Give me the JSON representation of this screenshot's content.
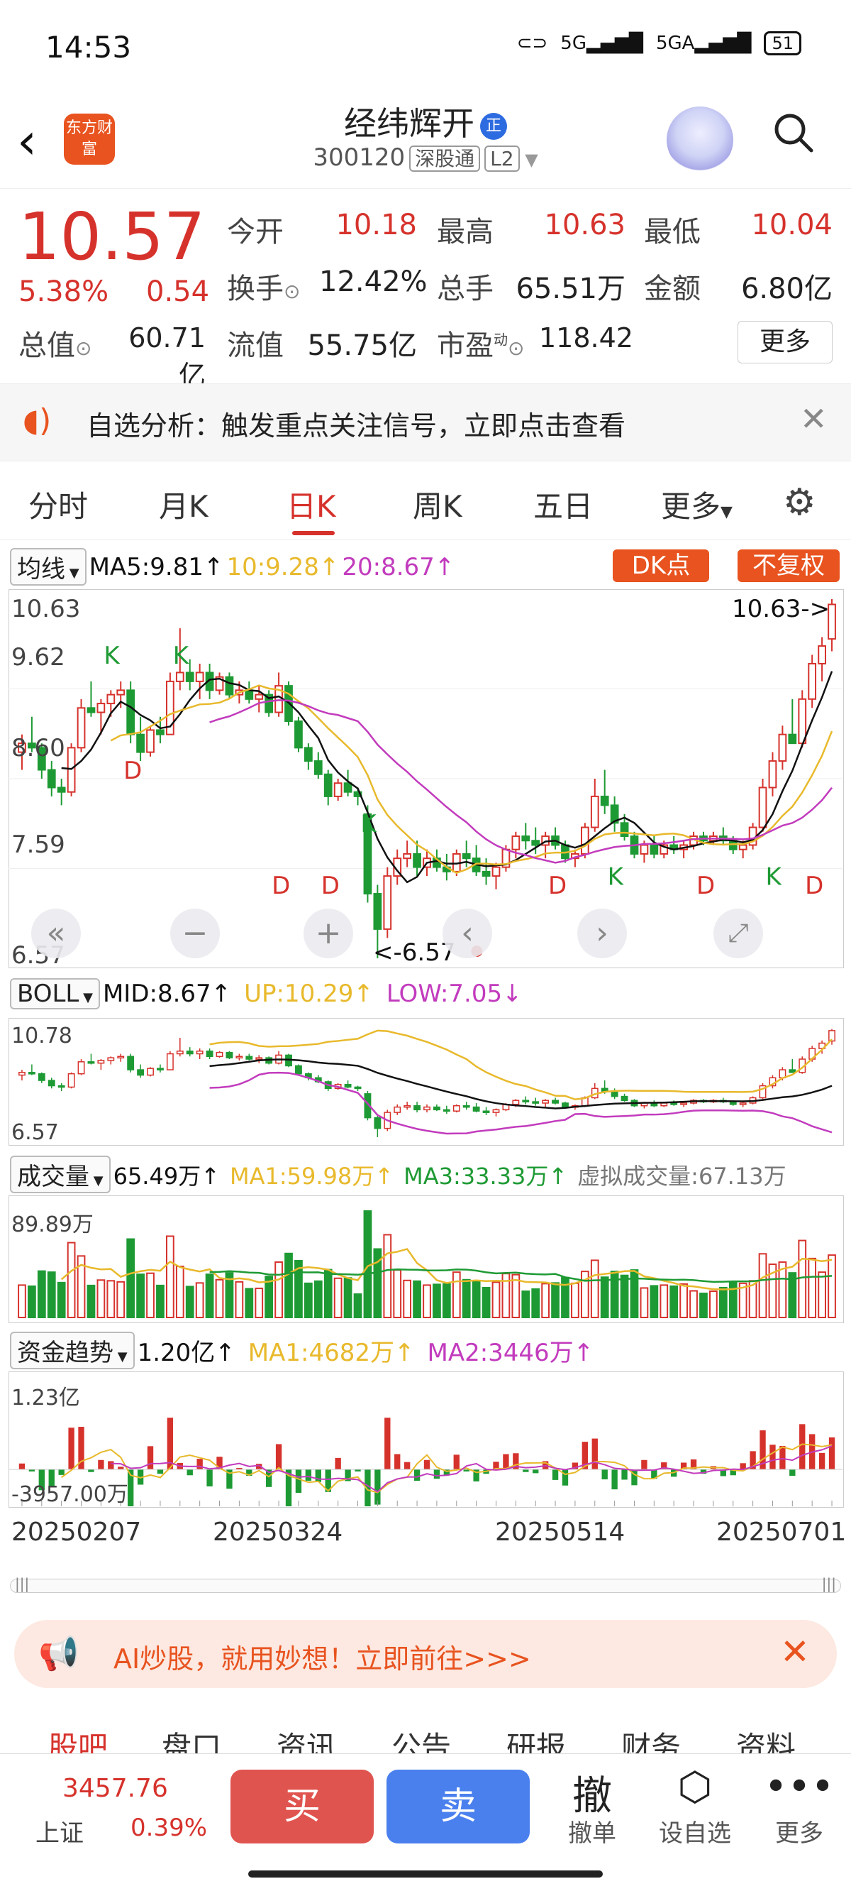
{
  "status": {
    "time": "14:53",
    "signal1": "5G",
    "signal2": "5GA",
    "battery": "51"
  },
  "header": {
    "back_icon": "chevron-left-icon",
    "app_logo": "东方财富",
    "title": "经纬辉开",
    "title_badge": "正",
    "code": "300120",
    "tag1": "深股通",
    "tag2": "L2"
  },
  "quote": {
    "price": "10.57",
    "change_pct": "5.38%",
    "change": "0.54",
    "open_label": "今开",
    "open": "10.18",
    "high_label": "最高",
    "high": "10.63",
    "low_label": "最低",
    "low": "10.04",
    "turnover_label": "换手",
    "turnover": "12.42%",
    "volume_label": "总手",
    "volume": "65.51万",
    "amount_label": "金额",
    "amount": "6.80亿",
    "mktcap_label": "总值",
    "mktcap": "60.71亿",
    "float_label": "流值",
    "float": "55.75亿",
    "pe_label": "市盈",
    "pe_sup": "动",
    "pe": "118.42",
    "more_label": "更多"
  },
  "banner": {
    "text": "自选分析：触发重点关注信号，立即点击查看"
  },
  "tabs": [
    "分时",
    "月K",
    "日K",
    "周K",
    "五日",
    "更多"
  ],
  "active_tab": "日K",
  "ma_row": {
    "select": "均线",
    "ma5": "MA5:9.81↑",
    "ma10": "10:9.28↑",
    "ma20": "20:8.67↑",
    "dk": "DK点",
    "fq": "不复权"
  },
  "kline": {
    "y_labels": [
      "10.63",
      "9.62",
      "8.60",
      "7.59",
      "6.57"
    ],
    "high_marker": "10.63->",
    "low_marker": "<-6.57",
    "signals": [
      "K",
      "D"
    ]
  },
  "boll_row": {
    "select": "BOLL",
    "mid": "MID:8.67↑",
    "up": "UP:10.29↑",
    "low": "LOW:7.05↓",
    "y_top": "10.78",
    "y_bottom": "6.57"
  },
  "vol_row": {
    "select": "成交量",
    "val": "65.49万↑",
    "ma1": "MA1:59.98万↑",
    "ma3": "MA3:33.33万↑",
    "virtual": "虚拟成交量:67.13万",
    "y_top": "89.89万"
  },
  "fund_row": {
    "select": "资金趋势",
    "val": "1.20亿↑",
    "ma1": "MA1:4682万↑",
    "ma2": "MA2:3446万↑",
    "y_top": "1.23亿",
    "y_bottom": "-3957.00万"
  },
  "dates": [
    "20250207",
    "20250324",
    "20250514",
    "20250701"
  ],
  "ai_banner": {
    "text": "AI炒股，就用妙想！立即前往>>>"
  },
  "bottom_tabs": [
    "股吧",
    "盘口",
    "资讯",
    "公告",
    "研报",
    "财务",
    "资料"
  ],
  "bottom_bar": {
    "index_value": "3457.76",
    "index_name": "上证",
    "index_pct": "0.39%",
    "buy": "买",
    "sell": "卖",
    "cancel_icon": "撤",
    "cancel_label": "撤单",
    "watch_label": "设自选",
    "more_label": "更多"
  },
  "colors": {
    "up": "#d6322c",
    "down": "#1e9a34",
    "ma5": "#111111",
    "ma10": "#e8b92c",
    "ma20": "#c23bbd",
    "accent": "#e8531f"
  },
  "chart_data": {
    "type": "candlestick",
    "ylim": [
      6.57,
      10.63
    ],
    "candles": [
      [
        8.9,
        9.1,
        8.7,
        9.0
      ],
      [
        9.0,
        9.3,
        8.9,
        8.95
      ],
      [
        8.95,
        9.0,
        8.6,
        8.7
      ],
      [
        8.7,
        8.8,
        8.4,
        8.5
      ],
      [
        8.5,
        8.6,
        8.3,
        8.45
      ],
      [
        8.45,
        9.0,
        8.4,
        8.95
      ],
      [
        8.95,
        9.5,
        8.9,
        9.4
      ],
      [
        9.4,
        9.7,
        9.3,
        9.35
      ],
      [
        9.35,
        9.5,
        9.1,
        9.45
      ],
      [
        9.45,
        9.6,
        9.3,
        9.55
      ],
      [
        9.55,
        9.7,
        9.4,
        9.6
      ],
      [
        9.6,
        9.7,
        9.0,
        9.1
      ],
      [
        9.1,
        9.3,
        8.8,
        8.9
      ],
      [
        8.9,
        9.2,
        8.85,
        9.15
      ],
      [
        9.15,
        9.3,
        9.0,
        9.1
      ],
      [
        9.1,
        9.8,
        9.1,
        9.7
      ],
      [
        9.7,
        10.3,
        9.6,
        9.8
      ],
      [
        9.8,
        9.95,
        9.6,
        9.7
      ],
      [
        9.7,
        9.9,
        9.5,
        9.8
      ],
      [
        9.8,
        9.9,
        9.5,
        9.6
      ],
      [
        9.6,
        9.8,
        9.55,
        9.75
      ],
      [
        9.75,
        9.8,
        9.5,
        9.55
      ],
      [
        9.55,
        9.7,
        9.45,
        9.6
      ],
      [
        9.6,
        9.7,
        9.45,
        9.5
      ],
      [
        9.5,
        9.65,
        9.35,
        9.55
      ],
      [
        9.55,
        9.6,
        9.3,
        9.35
      ],
      [
        9.35,
        9.8,
        9.3,
        9.65
      ],
      [
        9.65,
        9.7,
        9.2,
        9.25
      ],
      [
        9.25,
        9.3,
        8.9,
        8.95
      ],
      [
        8.95,
        9.0,
        8.7,
        8.8
      ],
      [
        8.8,
        8.9,
        8.6,
        8.65
      ],
      [
        8.65,
        8.7,
        8.3,
        8.4
      ],
      [
        8.4,
        8.6,
        8.35,
        8.55
      ],
      [
        8.55,
        8.7,
        8.4,
        8.45
      ],
      [
        8.45,
        8.5,
        8.3,
        8.4
      ],
      [
        8.2,
        8.3,
        7.2,
        7.3
      ],
      [
        7.3,
        7.4,
        6.57,
        6.9
      ],
      [
        6.9,
        7.6,
        6.8,
        7.5
      ],
      [
        7.5,
        7.8,
        7.4,
        7.7
      ],
      [
        7.7,
        7.9,
        7.6,
        7.75
      ],
      [
        7.75,
        7.9,
        7.5,
        7.6
      ],
      [
        7.6,
        7.8,
        7.5,
        7.7
      ],
      [
        7.7,
        7.8,
        7.55,
        7.6
      ],
      [
        7.6,
        7.75,
        7.45,
        7.55
      ],
      [
        7.55,
        7.8,
        7.5,
        7.75
      ],
      [
        7.75,
        7.9,
        7.6,
        7.7
      ],
      [
        7.7,
        7.85,
        7.5,
        7.55
      ],
      [
        7.55,
        7.7,
        7.4,
        7.5
      ],
      [
        7.5,
        7.65,
        7.35,
        7.6
      ],
      [
        7.6,
        7.85,
        7.55,
        7.8
      ],
      [
        7.8,
        8.0,
        7.7,
        7.95
      ],
      [
        7.95,
        8.1,
        7.8,
        7.9
      ],
      [
        7.9,
        8.05,
        7.75,
        7.85
      ],
      [
        7.85,
        8.0,
        7.7,
        7.95
      ],
      [
        7.95,
        8.05,
        7.8,
        7.85
      ],
      [
        7.85,
        7.9,
        7.65,
        7.7
      ],
      [
        7.7,
        7.8,
        7.6,
        7.75
      ],
      [
        7.75,
        8.1,
        7.7,
        8.05
      ],
      [
        8.05,
        8.6,
        8.0,
        8.4
      ],
      [
        8.4,
        8.7,
        8.2,
        8.3
      ],
      [
        8.3,
        8.4,
        8.0,
        8.1
      ],
      [
        8.1,
        8.2,
        7.9,
        7.95
      ],
      [
        7.95,
        8.0,
        7.7,
        7.75
      ],
      [
        7.75,
        7.9,
        7.65,
        7.85
      ],
      [
        7.85,
        7.95,
        7.7,
        7.75
      ],
      [
        7.75,
        7.9,
        7.7,
        7.85
      ],
      [
        7.85,
        7.95,
        7.75,
        7.8
      ],
      [
        7.8,
        7.9,
        7.7,
        7.85
      ],
      [
        7.85,
        8.0,
        7.8,
        7.95
      ],
      [
        7.95,
        8.0,
        7.85,
        7.9
      ],
      [
        7.9,
        8.0,
        7.85,
        7.95
      ],
      [
        7.95,
        8.05,
        7.85,
        7.9
      ],
      [
        7.9,
        7.95,
        7.75,
        7.8
      ],
      [
        7.8,
        7.9,
        7.7,
        7.85
      ],
      [
        7.85,
        8.1,
        7.8,
        8.05
      ],
      [
        8.05,
        8.6,
        8.0,
        8.5
      ],
      [
        8.5,
        8.9,
        8.4,
        8.8
      ],
      [
        8.8,
        9.2,
        8.7,
        9.1
      ],
      [
        9.1,
        9.5,
        9.0,
        9.0
      ],
      [
        9.0,
        9.6,
        8.95,
        9.5
      ],
      [
        9.5,
        10.0,
        9.4,
        9.9
      ],
      [
        9.9,
        10.2,
        9.7,
        10.1
      ],
      [
        10.18,
        10.63,
        10.04,
        10.57
      ]
    ]
  }
}
